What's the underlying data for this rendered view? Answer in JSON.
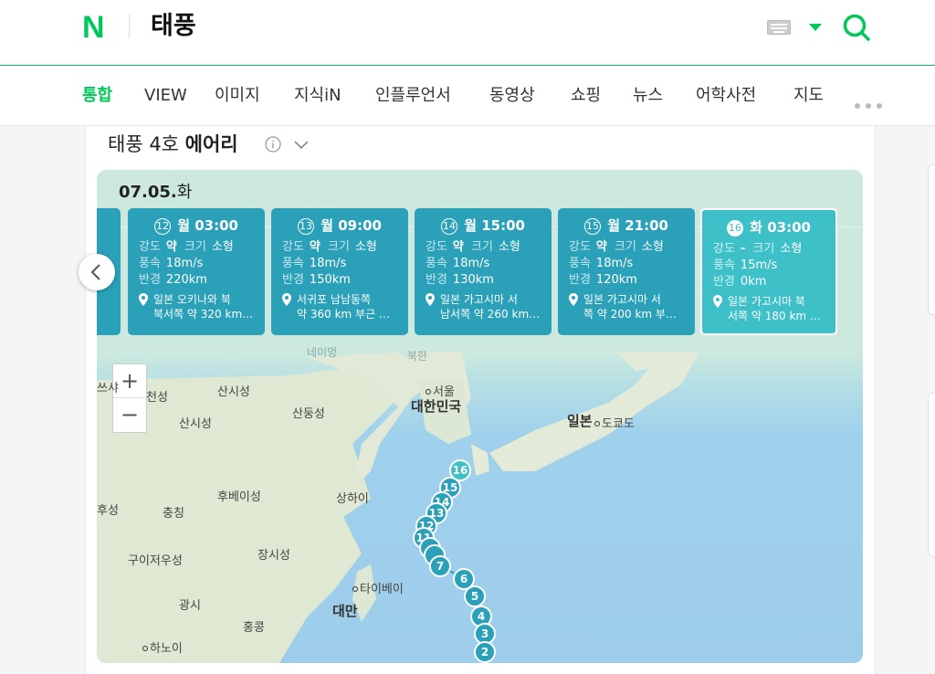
{
  "header": {
    "logo": "N",
    "query": "태풍"
  },
  "tabs": [
    "통합",
    "VIEW",
    "이미지",
    "지식iN",
    "인플루언서",
    "동영상",
    "쇼핑",
    "뉴스",
    "어학사전",
    "지도"
  ],
  "card": {
    "title_prefix": "태풍 4호 ",
    "title_name": "에어리"
  },
  "date": {
    "day": "07.05.",
    "weekday": "화"
  },
  "forecasts": [
    {
      "num": "12",
      "time": "월 03:00",
      "strength": "약",
      "size": "소형",
      "wind": "18m/s",
      "radius": "220km",
      "loc1": "일본 오키나와 북",
      "loc2": "북서쪽 약 320 km…"
    },
    {
      "num": "13",
      "time": "월 09:00",
      "strength": "약",
      "size": "소형",
      "wind": "18m/s",
      "radius": "150km",
      "loc1": "서귀포 남남동쪽",
      "loc2": "약 360 km 부근 …"
    },
    {
      "num": "14",
      "time": "월 15:00",
      "strength": "약",
      "size": "소형",
      "wind": "18m/s",
      "radius": "130km",
      "loc1": "일본 가고시마 서",
      "loc2": "남서쪽 약 260 km…"
    },
    {
      "num": "15",
      "time": "월 21:00",
      "strength": "약",
      "size": "소형",
      "wind": "18m/s",
      "radius": "120km",
      "loc1": "일본 가고시마 서",
      "loc2": "쪽 약 200 km 부…"
    },
    {
      "num": "16",
      "time": "화 03:00",
      "strength": "-",
      "size": "소형",
      "wind": "15m/s",
      "radius": "0km",
      "loc1": "일본 가고시마 북",
      "loc2": "서쪽 약 180 km …"
    }
  ],
  "labels": {
    "strength": "강도",
    "size": "크기",
    "wind": "풍속",
    "radius": "반경"
  },
  "zoom": {
    "plus": "+",
    "minus": "−"
  },
  "map_labels": [
    "북한",
    "대한민국",
    "서울",
    "일본",
    "도쿄도",
    "산시성",
    "산시성",
    "산둥성",
    "후베이성",
    "상하이",
    "충칭",
    "구이저우성",
    "장시성",
    "광시",
    "홍콩",
    "타이베이",
    "대만",
    "하노이",
    "쓰샤",
    "천성",
    "후성",
    "네이멍"
  ],
  "track_points": [
    "16",
    "15",
    "14",
    "13",
    "12",
    "11",
    "7",
    "6",
    "5",
    "4",
    "3",
    "2"
  ]
}
